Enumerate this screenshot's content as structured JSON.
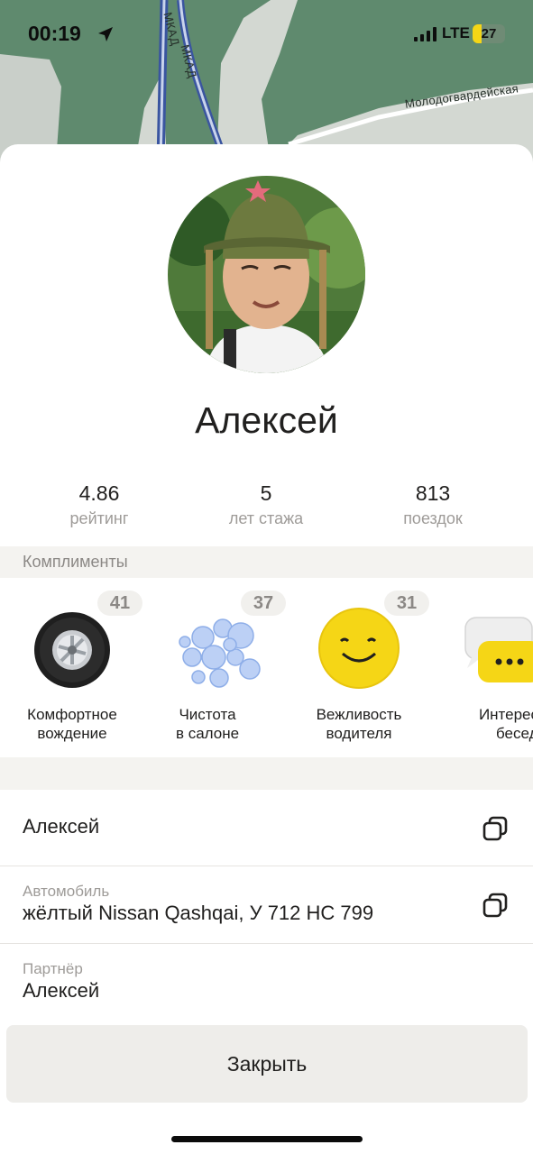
{
  "status_bar": {
    "time": "00:19",
    "network": "LTE",
    "battery": "27",
    "battery_level": 0.27
  },
  "map": {
    "road_label_1": "МКАД",
    "road_label_2": "МКАД",
    "street_label": "Молодогвардейская"
  },
  "driver": {
    "name": "Алексей",
    "stats": [
      {
        "value": "4.86",
        "label": "рейтинг"
      },
      {
        "value": "5",
        "label": "лет стажа"
      },
      {
        "value": "813",
        "label": "поездок"
      }
    ]
  },
  "compliments": {
    "title": "Комплименты",
    "items": [
      {
        "count": "41",
        "line1": "Комфортное",
        "line2": "вождение",
        "icon": "wheel-icon"
      },
      {
        "count": "37",
        "line1": "Чистота",
        "line2": "в салоне",
        "icon": "bubbles-icon"
      },
      {
        "count": "31",
        "line1": "Вежливость",
        "line2": "водителя",
        "icon": "smiley-icon"
      },
      {
        "count": "",
        "line1": "Интересная",
        "line2": "беседа",
        "icon": "chat-bubbles-icon"
      }
    ]
  },
  "details": {
    "name_value": "Алексей",
    "car_caption": "Автомобиль",
    "car_value": "жёлтый Nissan Qashqai, У 712 НС 799",
    "partner_caption": "Партнёр",
    "partner_value": "Алексей"
  },
  "close_label": "Закрыть",
  "colors": {
    "map_green": "#5f8a6e",
    "accent_yellow": "#f5d616",
    "band_gray": "#f4f3f0",
    "text_primary": "#21201f",
    "text_secondary": "#9e9b98"
  }
}
